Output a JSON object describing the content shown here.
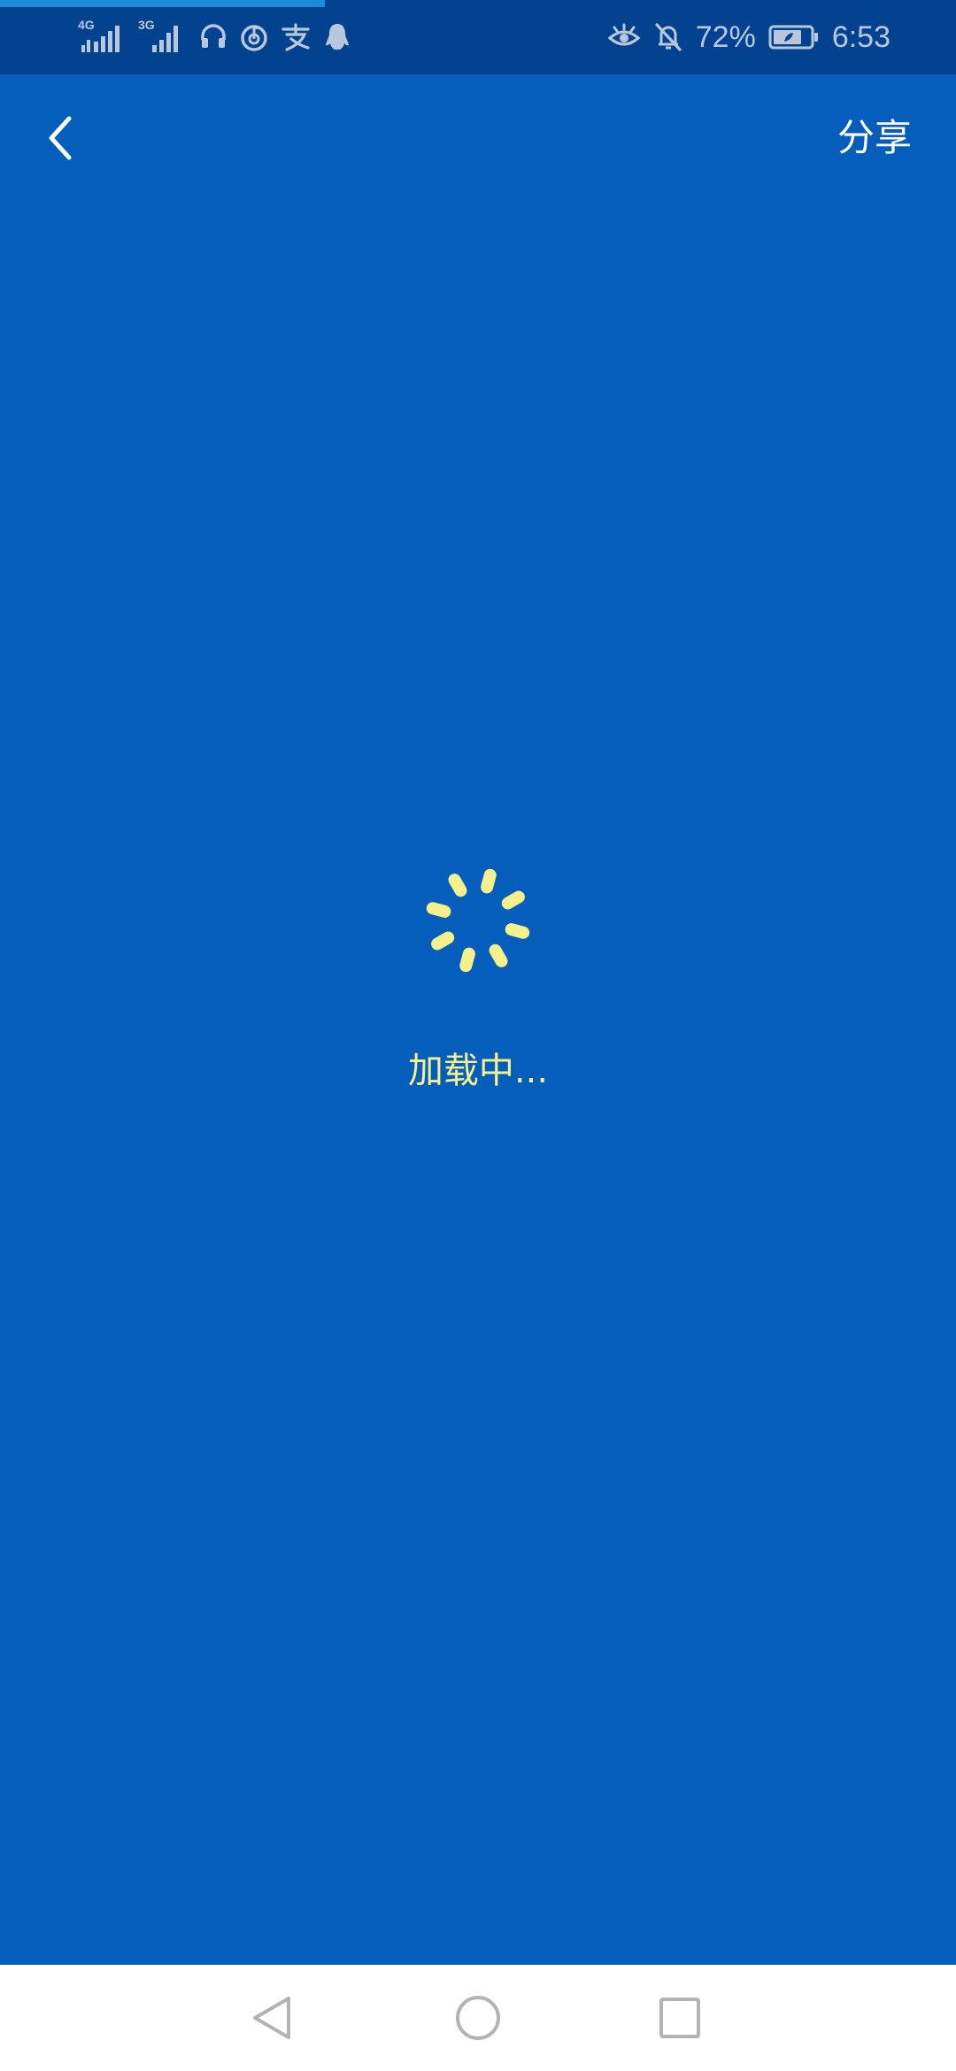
{
  "status_bar": {
    "network_1": "4G",
    "network_2": "3G",
    "battery_percent": "72%",
    "time": "6:53",
    "icons": [
      "4g-signal-icon",
      "3g-signal-icon",
      "headset-icon",
      "netease-music-icon",
      "alipay-icon",
      "qq-icon",
      "eye-comfort-icon",
      "notifications-muted-icon",
      "battery-icon"
    ]
  },
  "page_load_progress": 0.34,
  "header": {
    "back_icon": "chevron-left-icon",
    "share_label": "分享"
  },
  "loading": {
    "spinner_icon": "loading-spinner-icon",
    "text": "加载中..."
  },
  "nav_bar": {
    "back": "triangle-back-icon",
    "home": "circle-home-icon",
    "recents": "square-recents-icon"
  },
  "colors": {
    "background": "#055DBC",
    "status_bar": "#03428E",
    "progress": "#1F8AD6",
    "spinner": "#F5F08A",
    "header_text": "#FFFFFF",
    "nav_bar": "#FFFFFF",
    "nav_icons": "#B3B3B3"
  }
}
